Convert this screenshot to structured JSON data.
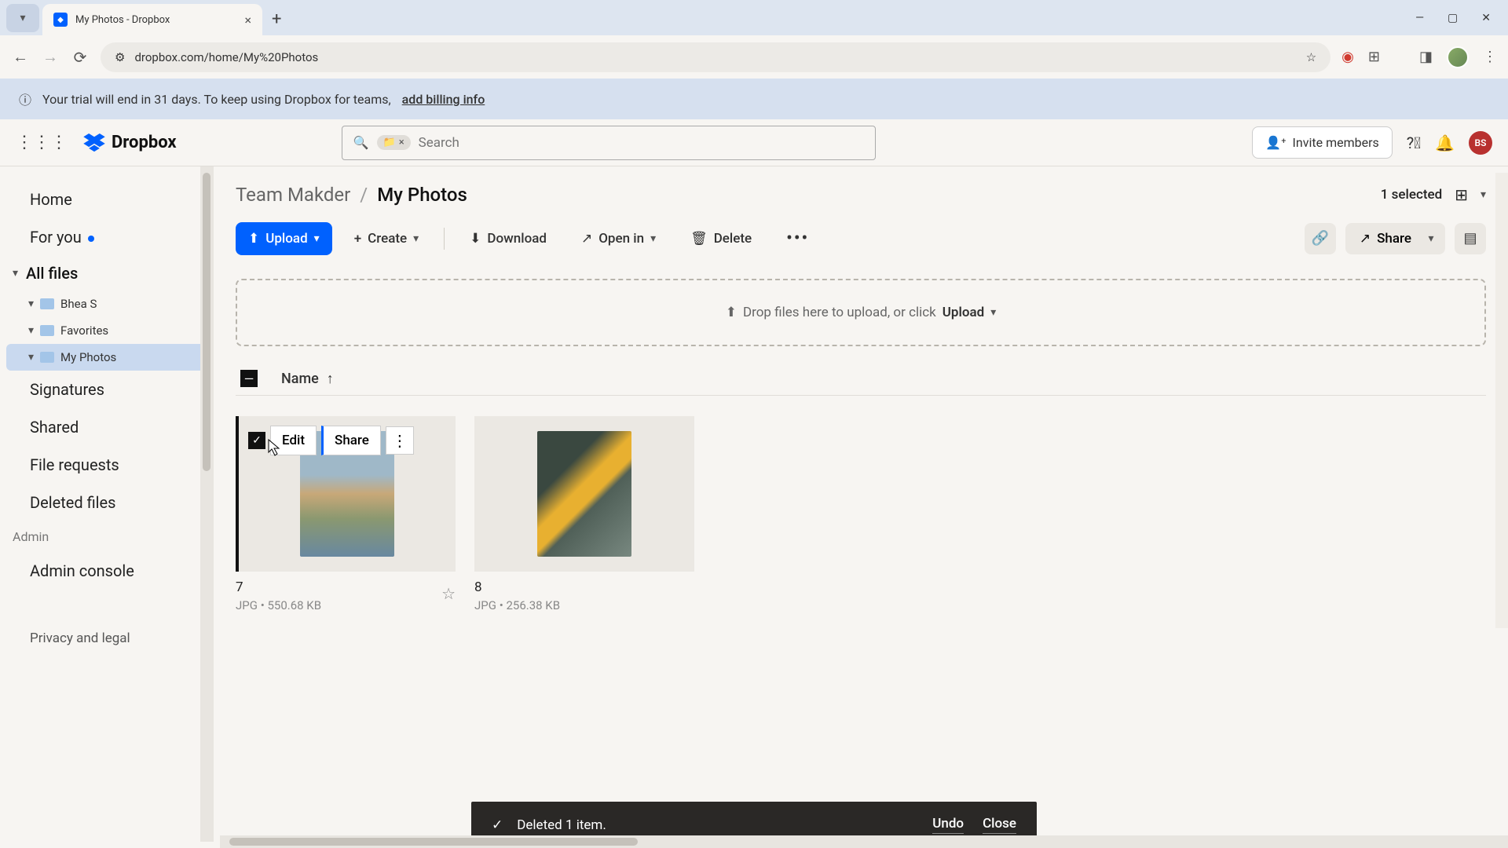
{
  "browser": {
    "tab_title": "My Photos - Dropbox",
    "url": "dropbox.com/home/My%20Photos"
  },
  "banner": {
    "text": "Your trial will end in 31 days. To keep using Dropbox for teams,",
    "link": "add billing info"
  },
  "header": {
    "brand": "Dropbox",
    "search_placeholder": "Search",
    "invite": "Invite members",
    "avatar_initials": "BS"
  },
  "sidebar": {
    "home": "Home",
    "for_you": "For you",
    "all_files": "All files",
    "tree": [
      {
        "label": "Bhea S"
      },
      {
        "label": "Favorites"
      },
      {
        "label": "My Photos"
      }
    ],
    "signatures": "Signatures",
    "shared": "Shared",
    "file_requests": "File requests",
    "deleted": "Deleted files",
    "admin": "Admin",
    "admin_console": "Admin console",
    "privacy": "Privacy and legal"
  },
  "breadcrumb": {
    "parent": "Team Makder",
    "current": "My Photos",
    "selected": "1 selected"
  },
  "toolbar": {
    "upload": "Upload",
    "create": "Create",
    "download": "Download",
    "open_in": "Open in",
    "delete": "Delete",
    "share": "Share"
  },
  "dropzone": {
    "pre": "Drop files here to upload, or click",
    "action": "Upload"
  },
  "columns": {
    "name": "Name"
  },
  "files": [
    {
      "name": "7",
      "type": "JPG",
      "size": "550.68 KB",
      "edit": "Edit",
      "share": "Share"
    },
    {
      "name": "8",
      "type": "JPG",
      "size": "256.38 KB"
    }
  ],
  "toast": {
    "msg": "Deleted 1 item.",
    "undo": "Undo",
    "close": "Close"
  }
}
